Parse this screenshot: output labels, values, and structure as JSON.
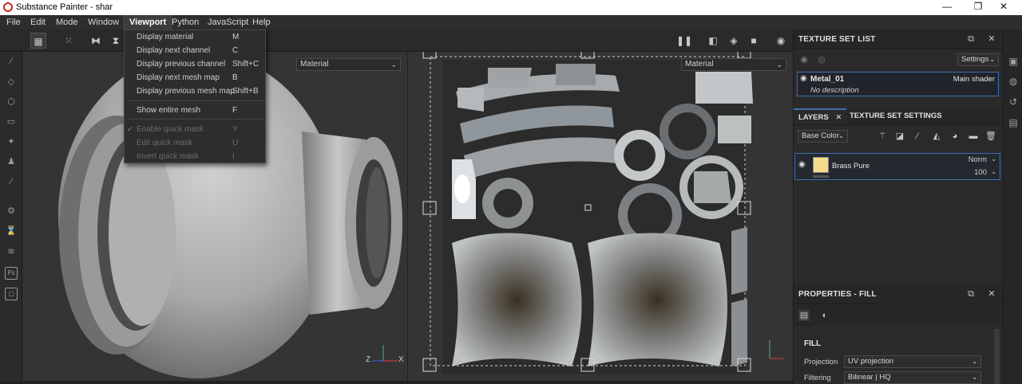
{
  "window": {
    "title": "Substance Painter - shar",
    "min_glyph": "—",
    "max_glyph": "❐",
    "close_glyph": "✕"
  },
  "menubar": {
    "items": [
      "File",
      "Edit",
      "Mode",
      "Window",
      "Viewport",
      "Python",
      "JavaScript",
      "Help"
    ],
    "active": "Viewport"
  },
  "viewport_menu": {
    "items": [
      {
        "label": "Display material",
        "shortcut": "M",
        "enabled": true
      },
      {
        "label": "Display next channel",
        "shortcut": "C",
        "enabled": true
      },
      {
        "label": "Display previous channel",
        "shortcut": "Shift+C",
        "enabled": true
      },
      {
        "label": "Display next mesh map",
        "shortcut": "B",
        "enabled": true
      },
      {
        "label": "Display previous mesh map",
        "shortcut": "Shift+B",
        "enabled": true
      },
      {
        "label": "Show entire mesh",
        "shortcut": "F",
        "enabled": true
      },
      {
        "label": "Enable quick mask",
        "shortcut": "Y",
        "enabled": false,
        "checked": true
      },
      {
        "label": "Edit quick mask",
        "shortcut": "U",
        "enabled": false
      },
      {
        "label": "Invert quick mask",
        "shortcut": "I",
        "enabled": false
      }
    ]
  },
  "viewport3d": {
    "display_mode": "Material",
    "gizmo": {
      "x": "X",
      "y": "Y",
      "z": "Z"
    }
  },
  "viewport2d": {
    "display_mode": "Material"
  },
  "texture_set_list": {
    "title": "TEXTURE SET LIST",
    "settings_label": "Settings",
    "item": {
      "name": "Metal_01",
      "shader": "Main shader",
      "description": "No description"
    }
  },
  "layers_panel": {
    "tabs": [
      "LAYERS",
      "TEXTURE SET SETTINGS"
    ],
    "channel": "Base Color",
    "layer": {
      "name": "Brass Pure",
      "blend_mode": "Norm",
      "opacity": "100",
      "thumbnail_color": "#f5dc8c"
    }
  },
  "properties": {
    "title": "PROPERTIES - FILL",
    "section": "FILL",
    "projection_label": "Projection",
    "projection_value": "UV projection",
    "filtering_label": "Filtering",
    "filtering_value": "Bilinear | HQ"
  },
  "colors": {
    "accent": "#3c6eb4",
    "background": "#2a2a2a",
    "brass": "#f5dc8c"
  }
}
